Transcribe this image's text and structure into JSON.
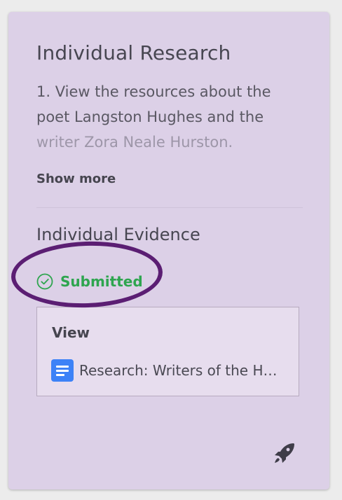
{
  "card": {
    "title": "Individual Research",
    "description_visible": "1. View the resources about the poet Langston Hughes and the",
    "description_faded": "writer Zora Neale Hurston.",
    "show_more_label": "Show more"
  },
  "evidence": {
    "title": "Individual Evidence",
    "status": "Submitted",
    "status_color": "#2ea54f",
    "view_label": "View",
    "document": {
      "title": "Research: Writers of the H…",
      "icon": "google-docs-icon"
    }
  },
  "icons": {
    "status": "check-circle-icon",
    "action": "rocket-icon"
  },
  "colors": {
    "card_background": "#dcd0e7",
    "highlight_annotation": "#5b1e73",
    "docs_blue": "#3d82f7"
  }
}
